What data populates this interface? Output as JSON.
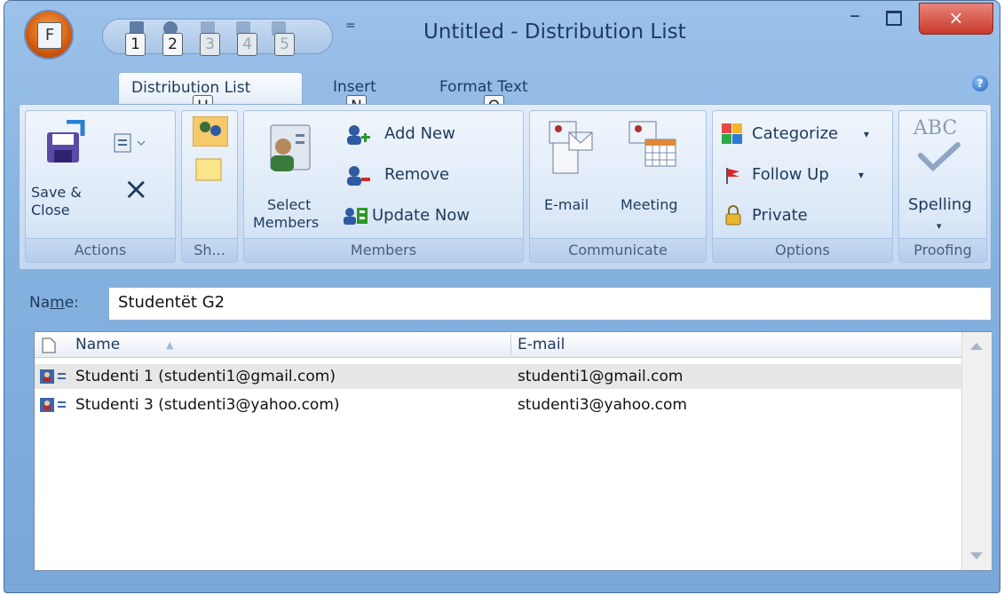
{
  "window": {
    "title": "Untitled - Distribution List",
    "office_button_keytip": "F",
    "qat_keytips": [
      "1",
      "2",
      "3",
      "4",
      "5"
    ],
    "qat_dropdown": "=",
    "minimize": "–",
    "close": "×",
    "help": "?"
  },
  "tabs": [
    {
      "label": "Distribution List",
      "keytip": "H",
      "active": true
    },
    {
      "label": "Insert",
      "keytip": "N",
      "active": false
    },
    {
      "label": "Format Text",
      "keytip": "O",
      "active": false
    }
  ],
  "ribbon": {
    "actions": {
      "label": "Actions",
      "save_close_line1": "Save &",
      "save_close_line2": "Close",
      "delete": "×"
    },
    "show": {
      "label": "Sh..."
    },
    "members": {
      "label": "Members",
      "select_line1": "Select",
      "select_line2": "Members",
      "add_new": "Add New",
      "remove": "Remove",
      "update_now": "Update Now"
    },
    "communicate": {
      "label": "Communicate",
      "email": "E-mail",
      "meeting": "Meeting"
    },
    "options": {
      "label": "Options",
      "categorize": "Categorize",
      "follow_up": "Follow Up",
      "private": "Private"
    },
    "proofing": {
      "label": "Proofing",
      "spelling": "Spelling",
      "abc": "ABC"
    }
  },
  "form": {
    "name_label_prefix": "Na",
    "name_label_underlined": "m",
    "name_label_suffix": "e:",
    "name_value": "Studentët G2"
  },
  "members_list": {
    "columns": [
      "Name",
      "E-mail"
    ],
    "sort_indicator": "▲",
    "rows": [
      {
        "name": "Studenti 1 (studenti1@gmail.com)",
        "email": "studenti1@gmail.com",
        "selected": true
      },
      {
        "name": "Studenti 3 (studenti3@yahoo.com)",
        "email": "studenti3@yahoo.com",
        "selected": false
      }
    ]
  }
}
